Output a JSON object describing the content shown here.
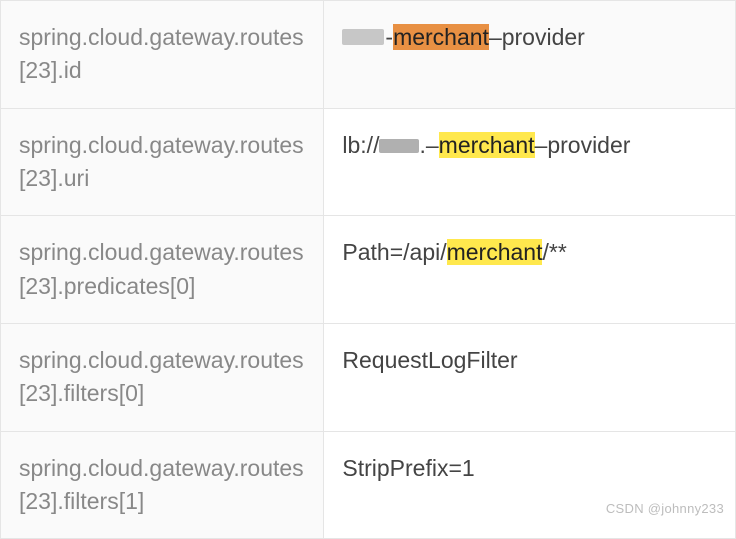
{
  "rows": [
    {
      "key": "spring.cloud.gateway.routes[23].id",
      "hl": "merchant",
      "hlClass": "hl-orange",
      "pre": "-",
      "post": "–provider"
    },
    {
      "key": "spring.cloud.gateway.routes[23].uri",
      "prefix": "lb://",
      "hl": "merchant",
      "hlClass": "hl-yellow",
      "pre": ".–",
      "post": "–provider"
    },
    {
      "key": "spring.cloud.gateway.routes[23].predicates[0]",
      "prefix": "Path=/api/",
      "hl": "merchant",
      "hlClass": "hl-yellow",
      "post": "/**"
    },
    {
      "key": "spring.cloud.gateway.routes[23].filters[0]",
      "value": "RequestLogFilter"
    },
    {
      "key": "spring.cloud.gateway.routes[23].filters[1]",
      "value": "StripPrefix=1"
    }
  ],
  "watermark": "CSDN @johnny233"
}
